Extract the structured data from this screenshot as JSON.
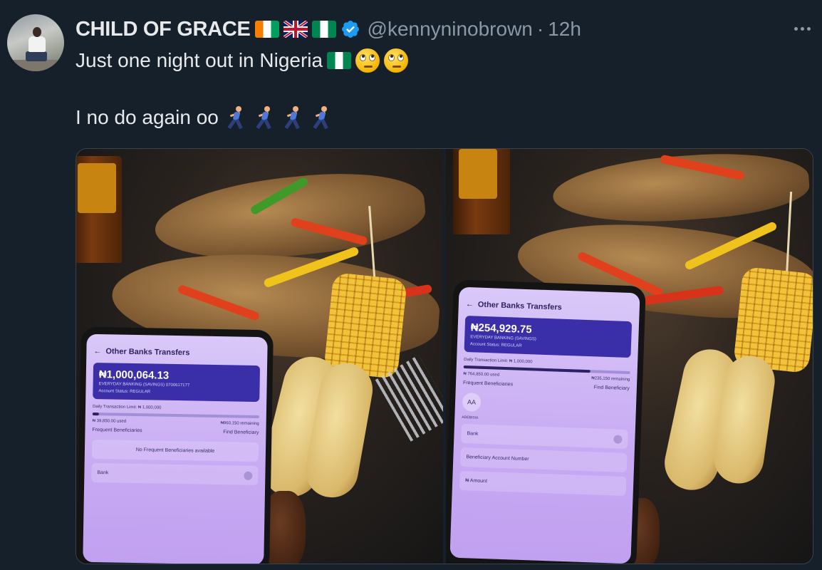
{
  "tweet": {
    "display_name": "CHILD OF GRACE",
    "handle": "@kennyninobrown",
    "separator": "·",
    "time": "12h",
    "text_line1": "Just one night out in Nigeria",
    "text_line2": "I no do again oo"
  },
  "icons": {
    "flags": [
      "flag-cote-divoire-icon",
      "flag-uk-icon",
      "flag-nigeria-icon"
    ],
    "verified": "verified-badge-icon",
    "more": "more-icon",
    "emoji_line1": [
      "flag-nigeria-icon",
      "face-rolling-eyes-icon",
      "face-rolling-eyes-icon"
    ],
    "emoji_line2": [
      "runner-icon",
      "runner-icon",
      "runner-icon",
      "runner-icon"
    ]
  },
  "colors": {
    "background": "#15202b",
    "text": "#e7e9ea",
    "secondary": "#8b98a5",
    "verified": "#1d9bf0"
  },
  "media": {
    "left_phone": {
      "title": "Other Banks Transfers",
      "amount": "₦1,000,064.13",
      "account_type": "EVERYDAY BANKING (SAVINGS) 0700617177",
      "account_status": "Account Status: REGULAR",
      "daily_limit": "Daily Transaction Limit: ₦ 1,000,000",
      "used": "₦ 39,850.00 used",
      "remaining": "₦960,150 remaining",
      "used_fraction": 0.04,
      "frequent_label": "Frequent Beneficiaries",
      "find_label": "Find Beneficiary",
      "no_frequent": "No Frequent Beneficiaries available",
      "bank_field": "Bank"
    },
    "right_phone": {
      "title": "Other Banks Transfers",
      "amount": "₦254,929.75",
      "account_type": "EVERYDAY BANKING (SAVINGS)",
      "account_status": "Account Status: REGULAR",
      "daily_limit": "Daily Transaction Limit: ₦ 1,000,000",
      "used": "₦ 764,850.00 used",
      "remaining": "₦235,150 remaining",
      "used_fraction": 0.76,
      "frequent_label": "Frequent Beneficiaries",
      "find_label": "Find Beneficiary",
      "beneficiary_initials": "AA",
      "beneficiary_name": "ADEBISIA",
      "bank_field": "Bank",
      "account_number_field": "Beneficiary Account Number",
      "amount_field": "₦ Amount"
    }
  }
}
